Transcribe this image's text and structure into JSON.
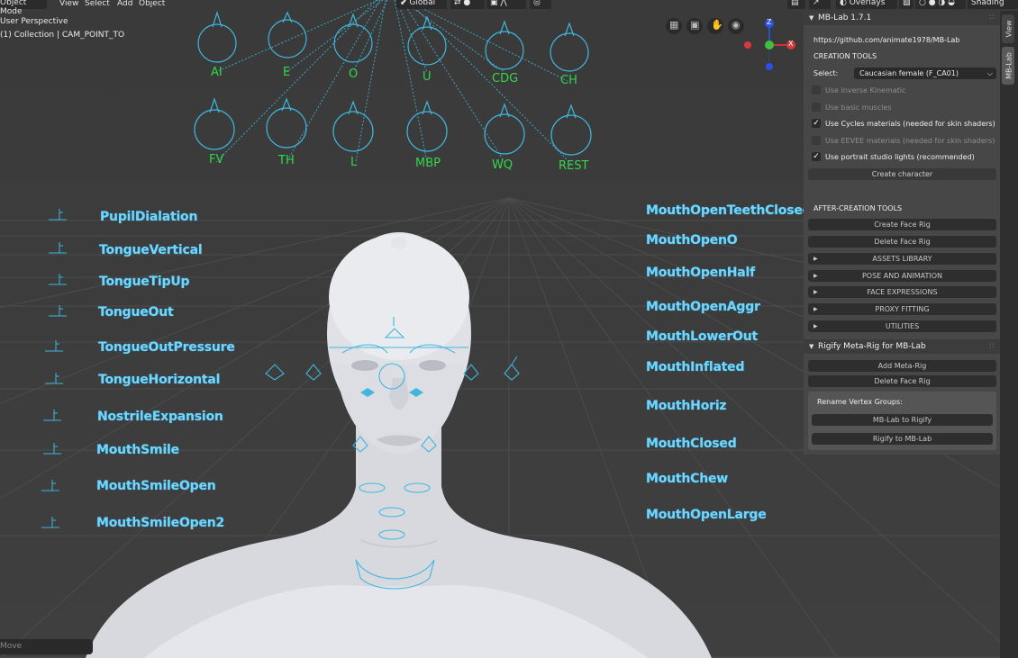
{
  "header": {
    "mode": "Object Mode",
    "menus": [
      "View",
      "Select",
      "Add",
      "Object"
    ],
    "transform_orientation": "Global",
    "overlays": "Overlays",
    "shading": "Shading"
  },
  "viewport": {
    "perspective": "User Perspective",
    "collection": "(1) Collection | CAM_POINT_TO"
  },
  "shape_keys_top": [
    "AI",
    "E",
    "O",
    "U",
    "CDG",
    "CH"
  ],
  "shape_keys_bottom": [
    "FV",
    "TH",
    "L",
    "MBP",
    "WQ",
    "REST"
  ],
  "bones_left": [
    "PupilDialation",
    "TongueVertical",
    "TongueTipUp",
    "TongueOut",
    "TongueOutPressure",
    "TongueHorizontal",
    "NostrileExpansion",
    "MouthSmile",
    "MouthSmileOpen",
    "MouthSmileOpen2"
  ],
  "bones_right": [
    "MouthOpenTeethClosed",
    "MouthOpenO",
    "MouthOpenHalf",
    "MouthOpenAggr",
    "MouthLowerOut",
    "MouthInflated",
    "MouthHoriz",
    "MouthClosed",
    "MouthChew",
    "MouthOpenLarge"
  ],
  "axis_gizmo": {
    "z": "Z",
    "x": "X",
    "y": "Y"
  },
  "mblab_panel": {
    "title": "MB-Lab 1.7.1",
    "url": "https://github.com/animate1978/MB-Lab",
    "creation_tools": "CREATION TOOLS",
    "select_label": "Select:",
    "select_value": "Caucasian female (F_CA01)",
    "options": [
      {
        "label": "Use Inverse Kinematic",
        "checked": false,
        "enabled": false
      },
      {
        "label": "Use basic muscles",
        "checked": false,
        "enabled": false
      },
      {
        "label": "Use Cycles materials (needed for skin shaders)",
        "checked": true,
        "enabled": true
      },
      {
        "label": "Use EEVEE materials (needed for skin shaders)",
        "checked": false,
        "enabled": false
      },
      {
        "label": "Use portrait studio lights (recommended)",
        "checked": true,
        "enabled": true
      }
    ],
    "create_character": "Create character",
    "after_creation_tools": "AFTER-CREATION TOOLS",
    "create_face_rig": "Create Face Rig",
    "delete_face_rig": "Delete Face Rig",
    "sections": [
      "ASSETS LIBRARY",
      "POSE AND ANIMATION",
      "FACE EXPRESSIONS",
      "PROXY FITTING",
      "UTILITIES"
    ]
  },
  "rigify_panel": {
    "title": "Rigify Meta-Rig for MB-Lab",
    "add_meta_rig": "Add Meta-Rig",
    "delete_face_rig": "Delete Face Rig",
    "rename_label": "Rename Vertex Groups:",
    "mblab_to_rigify": "MB-Lab to Rigify",
    "rigify_to_mblab": "Rigify to MB-Lab"
  },
  "side_tabs": [
    "View",
    "MB-Lab"
  ],
  "status": {
    "last_operation": "Move"
  }
}
